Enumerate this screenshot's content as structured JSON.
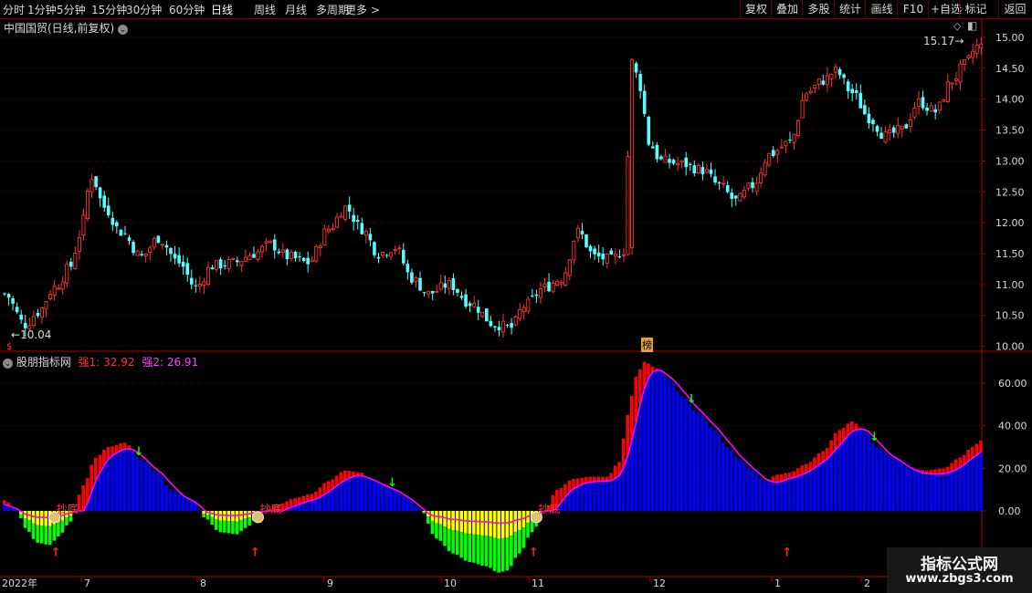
{
  "toolbar": {
    "periods": [
      "分时",
      "1分钟",
      "5分钟",
      "15分钟",
      "30分钟",
      "60分钟",
      "日线",
      "周线",
      "月线",
      "多周期",
      "更多 >"
    ],
    "active_period": "日线",
    "right_buttons": [
      "复权",
      "叠加",
      "多股",
      "统计",
      "画线",
      "F10",
      "+自选",
      "返回"
    ],
    "mark_label": "标记"
  },
  "colors": {
    "up": "#ff3232",
    "down": "#54ffff",
    "blue": "#0000ff",
    "red_bar": "#ff0000",
    "yellow": "#ffff00",
    "green": "#00ff00",
    "magenta": "#ff00ff",
    "axis": "#b40000"
  },
  "price_panel": {
    "title": "中国国贸(日线,前复权)",
    "low_label": "10.04",
    "high_label": "15.17",
    "marker": "榜"
  },
  "indicator_panel": {
    "title": "股朋指标网",
    "strong1_label": "强1: 32.92",
    "strong2_label": "强2: 26.91",
    "bottom_labels": [
      "抄底",
      "抄底",
      "抄底"
    ]
  },
  "chart_data": [
    {
      "type": "candlestick",
      "title": "中国国贸(日线,前复权)",
      "y_ticks": [
        10.0,
        10.5,
        11.0,
        11.5,
        12.0,
        12.5,
        13.0,
        13.5,
        14.0,
        14.5,
        15.0
      ],
      "ylim": [
        9.95,
        15.25
      ],
      "annotations": {
        "low": 10.04,
        "high": 15.17
      },
      "anchors": [
        [
          0,
          10.85
        ],
        [
          5,
          10.35
        ],
        [
          8,
          10.55
        ],
        [
          12,
          10.95
        ],
        [
          16,
          11.3
        ],
        [
          18,
          11.8
        ],
        [
          21,
          12.75
        ],
        [
          24,
          12.25
        ],
        [
          28,
          11.85
        ],
        [
          33,
          11.45
        ],
        [
          37,
          11.75
        ],
        [
          42,
          11.35
        ],
        [
          46,
          10.95
        ],
        [
          50,
          11.3
        ],
        [
          55,
          11.35
        ],
        [
          60,
          11.5
        ],
        [
          64,
          11.65
        ],
        [
          68,
          11.45
        ],
        [
          73,
          11.35
        ],
        [
          78,
          11.9
        ],
        [
          82,
          12.25
        ],
        [
          86,
          11.9
        ],
        [
          90,
          11.5
        ],
        [
          94,
          11.6
        ],
        [
          98,
          11.1
        ],
        [
          102,
          10.85
        ],
        [
          107,
          11.0
        ],
        [
          112,
          10.7
        ],
        [
          118,
          10.35
        ],
        [
          122,
          10.3
        ],
        [
          125,
          10.65
        ],
        [
          130,
          10.95
        ],
        [
          134,
          11.1
        ],
        [
          138,
          11.85
        ],
        [
          142,
          11.45
        ],
        [
          146,
          11.4
        ],
        [
          149,
          11.55
        ],
        [
          151,
          14.6
        ],
        [
          153,
          14.2
        ],
        [
          155,
          13.3
        ],
        [
          158,
          13.0
        ],
        [
          163,
          12.95
        ],
        [
          168,
          12.85
        ],
        [
          172,
          12.6
        ],
        [
          176,
          12.35
        ],
        [
          180,
          12.6
        ],
        [
          184,
          13.1
        ],
        [
          189,
          13.3
        ],
        [
          193,
          14.1
        ],
        [
          197,
          14.3
        ],
        [
          200,
          14.45
        ],
        [
          204,
          14.1
        ],
        [
          208,
          13.7
        ],
        [
          212,
          13.4
        ],
        [
          216,
          13.5
        ],
        [
          220,
          13.95
        ],
        [
          224,
          13.8
        ],
        [
          228,
          14.3
        ],
        [
          231,
          14.55
        ],
        [
          234,
          14.85
        ]
      ]
    },
    {
      "type": "bar",
      "title": "股朋指标网",
      "series": [
        {
          "name": "强1",
          "last_value": 32.92
        },
        {
          "name": "强2",
          "last_value": 26.91
        }
      ],
      "y_ticks": [
        0.0,
        20.0,
        40.0,
        60.0
      ],
      "ylim": [
        -30,
        72
      ],
      "anchors": [
        [
          0,
          5
        ],
        [
          3,
          1
        ],
        [
          5,
          -8
        ],
        [
          8,
          -15
        ],
        [
          11,
          -16
        ],
        [
          13,
          -12
        ],
        [
          16,
          -5
        ],
        [
          19,
          12
        ],
        [
          22,
          25
        ],
        [
          25,
          30
        ],
        [
          29,
          32
        ],
        [
          33,
          24
        ],
        [
          37,
          18
        ],
        [
          40,
          10
        ],
        [
          43,
          7
        ],
        [
          46,
          4
        ],
        [
          48,
          -3
        ],
        [
          52,
          -10
        ],
        [
          56,
          -11
        ],
        [
          58,
          -8
        ],
        [
          62,
          -1
        ],
        [
          66,
          3
        ],
        [
          70,
          6
        ],
        [
          74,
          8
        ],
        [
          78,
          14
        ],
        [
          82,
          19
        ],
        [
          86,
          18
        ],
        [
          88,
          15
        ],
        [
          91,
          13
        ],
        [
          94,
          10
        ],
        [
          97,
          6
        ],
        [
          100,
          1
        ],
        [
          104,
          -13
        ],
        [
          108,
          -20
        ],
        [
          112,
          -24
        ],
        [
          116,
          -26
        ],
        [
          119,
          -29
        ],
        [
          121,
          -28
        ],
        [
          124,
          -20
        ],
        [
          127,
          -10
        ],
        [
          130,
          0
        ],
        [
          133,
          10
        ],
        [
          137,
          15
        ],
        [
          141,
          16
        ],
        [
          145,
          16
        ],
        [
          148,
          23
        ],
        [
          150,
          45
        ],
        [
          152,
          63
        ],
        [
          154,
          70
        ],
        [
          157,
          67
        ],
        [
          160,
          62
        ],
        [
          163,
          54
        ],
        [
          167,
          46
        ],
        [
          171,
          38
        ],
        [
          174,
          30
        ],
        [
          177,
          24
        ],
        [
          180,
          19
        ],
        [
          183,
          14
        ],
        [
          186,
          17
        ],
        [
          189,
          18
        ],
        [
          193,
          22
        ],
        [
          197,
          28
        ],
        [
          201,
          38
        ],
        [
          204,
          42
        ],
        [
          207,
          38
        ],
        [
          210,
          30
        ],
        [
          214,
          25
        ],
        [
          218,
          20
        ],
        [
          222,
          19
        ],
        [
          226,
          20
        ],
        [
          230,
          25
        ],
        [
          233,
          30
        ],
        [
          235,
          33
        ]
      ],
      "x_labels": [
        "2022年",
        "7",
        "8",
        "9",
        "10",
        "11",
        "12",
        "1",
        "2"
      ]
    }
  ]
}
